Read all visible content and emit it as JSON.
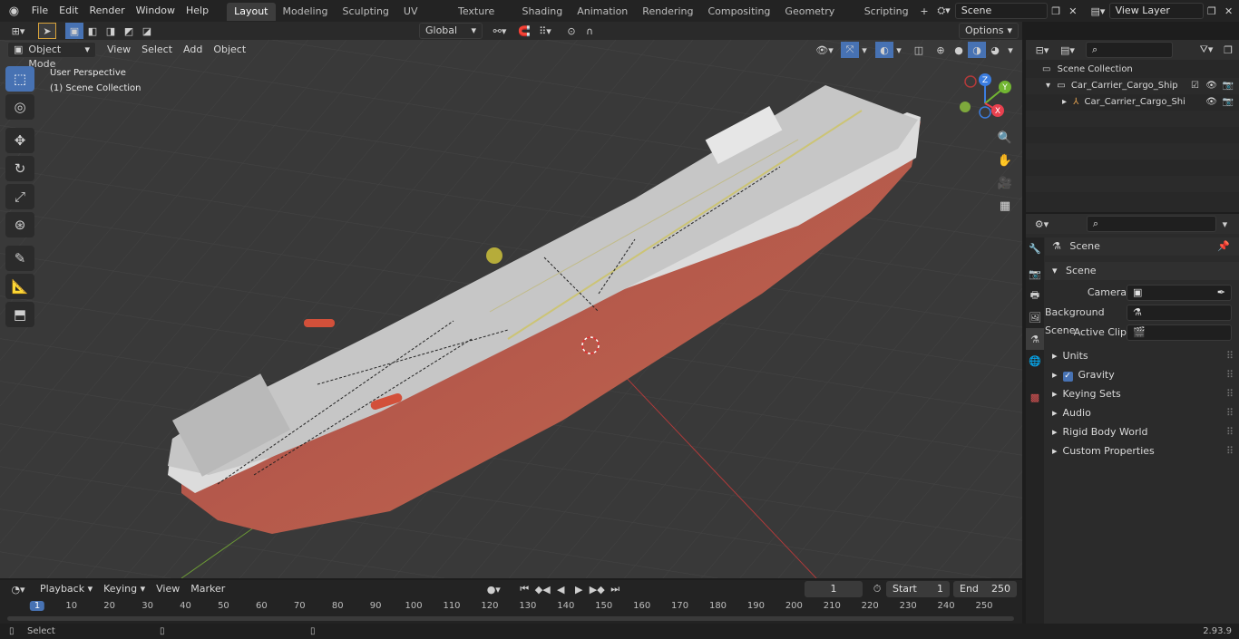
{
  "menu": [
    "File",
    "Edit",
    "Render",
    "Window",
    "Help"
  ],
  "workspaces": [
    "Layout",
    "Modeling",
    "Sculpting",
    "UV Editing",
    "Texture Paint",
    "Shading",
    "Animation",
    "Rendering",
    "Compositing",
    "Geometry Nodes",
    "Scripting"
  ],
  "active_workspace": "Layout",
  "scene_name": "Scene",
  "view_layer": "View Layer",
  "transform_orientation": "Global",
  "options_label": "Options",
  "mode": "Object Mode",
  "viewport_menus": [
    "View",
    "Select",
    "Add",
    "Object"
  ],
  "viewport_overlay": {
    "line1": "User Perspective",
    "line2": "(1) Scene Collection"
  },
  "gizmo_axes": {
    "z": "Z",
    "y": "Y",
    "x": "X"
  },
  "outliner": {
    "root": "Scene Collection",
    "items": [
      {
        "label": "Car_Carrier_Cargo_Ship",
        "level": 1
      },
      {
        "label": "Car_Carrier_Cargo_Ship_",
        "level": 2
      }
    ]
  },
  "properties": {
    "header": "Scene",
    "section": "Scene",
    "fields": [
      {
        "label": "Camera"
      },
      {
        "label": "Background Scene"
      },
      {
        "label": "Active Clip"
      }
    ],
    "panels": [
      "Units",
      "Gravity",
      "Keying Sets",
      "Audio",
      "Rigid Body World",
      "Custom Properties"
    ]
  },
  "timeline": {
    "menus": [
      "Playback",
      "Keying",
      "View",
      "Marker"
    ],
    "current_frame": "1",
    "start_label": "Start",
    "start": "1",
    "end_label": "End",
    "end": "250",
    "ticks": [
      "1",
      "10",
      "20",
      "30",
      "40",
      "50",
      "60",
      "70",
      "80",
      "90",
      "100",
      "110",
      "120",
      "130",
      "140",
      "150",
      "160",
      "170",
      "180",
      "190",
      "200",
      "210",
      "220",
      "230",
      "240",
      "250"
    ]
  },
  "status": {
    "left": "Select",
    "version": "2.93.9"
  },
  "colors": {
    "accent": "#4772b3",
    "hull_red": "#8e3c38",
    "deck": "#c9c9c9",
    "x_axis": "#e8414f",
    "y_axis": "#72b632",
    "z_axis": "#3b7de0"
  }
}
